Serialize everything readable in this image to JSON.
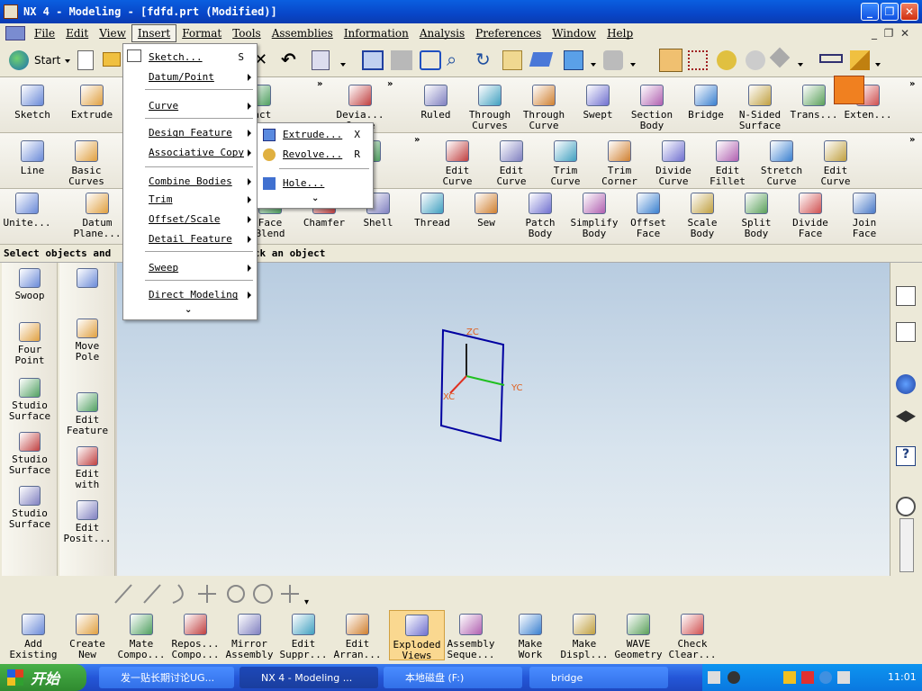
{
  "window": {
    "title": "NX 4 - Modeling - [fdfd.prt (Modified)]"
  },
  "menubar": {
    "items": [
      "File",
      "Edit",
      "View",
      "Insert",
      "Format",
      "Tools",
      "Assemblies",
      "Information",
      "Analysis",
      "Preferences",
      "Window",
      "Help"
    ]
  },
  "toolbar": {
    "start_label": "Start"
  },
  "ribbon1": [
    {
      "label": "Sketch",
      "icon": "sketch-icon"
    },
    {
      "label": "Extrude",
      "icon": "extrude-icon"
    },
    {
      "label": "ract\nature",
      "icon": "extract-feature-icon"
    },
    {
      "label": "Devia...\nCurve",
      "icon": "deviation-icon"
    },
    {
      "label": "Ruled",
      "icon": "ruled-icon"
    },
    {
      "label": "Through\nCurves",
      "icon": "through-curves-icon"
    },
    {
      "label": "Through\nCurve",
      "icon": "through-curve-mesh-icon"
    },
    {
      "label": "Swept",
      "icon": "swept-icon"
    },
    {
      "label": "Section\nBody",
      "icon": "section-body-icon"
    },
    {
      "label": "Bridge",
      "icon": "bridge-icon"
    },
    {
      "label": "N-Sided\nSurface",
      "icon": "n-sided-icon"
    },
    {
      "label": "Trans...",
      "icon": "transition-icon"
    },
    {
      "label": "Exten...",
      "icon": "extension-icon"
    }
  ],
  "ribbon2": [
    {
      "label": "Line",
      "icon": "line-icon"
    },
    {
      "label": "Basic\nCurves",
      "icon": "basic-curves-icon"
    },
    {
      "label": "e",
      "icon": "curve-partial-icon"
    },
    {
      "label": "Edit\nCurve",
      "icon": "edit-curve-icon"
    },
    {
      "label": "Edit\nCurve",
      "icon": "edit-curve-params-icon"
    },
    {
      "label": "Trim\nCurve",
      "icon": "trim-curve-icon"
    },
    {
      "label": "Trim\nCorner",
      "icon": "trim-corner-icon"
    },
    {
      "label": "Divide\nCurve",
      "icon": "divide-curve-icon"
    },
    {
      "label": "Edit\nFillet",
      "icon": "edit-fillet-icon"
    },
    {
      "label": "Stretch\nCurve",
      "icon": "stretch-curve-icon"
    },
    {
      "label": "Edit\nCurve",
      "icon": "edit-curve-length-icon"
    }
  ],
  "ribbon3": [
    {
      "label": "Unite...",
      "icon": "unite-icon"
    },
    {
      "label": "Datum\nPlane...",
      "icon": "datum-plane-icon"
    },
    {
      "label": "Face\nBlend",
      "icon": "face-blend-icon"
    },
    {
      "label": "Chamfer",
      "icon": "chamfer-icon"
    },
    {
      "label": "Shell",
      "icon": "shell-icon"
    },
    {
      "label": "Thread",
      "icon": "thread-icon"
    },
    {
      "label": "Sew",
      "icon": "sew-icon"
    },
    {
      "label": "Patch\nBody",
      "icon": "patch-body-icon"
    },
    {
      "label": "Simplify\nBody",
      "icon": "simplify-body-icon"
    },
    {
      "label": "Offset\nFace",
      "icon": "offset-face-icon"
    },
    {
      "label": "Scale\nBody",
      "icon": "scale-body-icon"
    },
    {
      "label": "Split\nBody",
      "icon": "split-body-icon"
    },
    {
      "label": "Divide\nFace",
      "icon": "divide-face-icon"
    },
    {
      "label": "Join\nFace",
      "icon": "join-face-icon"
    }
  ],
  "status": {
    "left": "Select objects and",
    "right": "ick an object"
  },
  "insert_menu": {
    "items": [
      {
        "label": "Sketch...",
        "shortcut": "S"
      },
      {
        "label": "Datum/Point"
      },
      {
        "label": "Curve"
      },
      {
        "label": "Design Feature"
      },
      {
        "label": "Associative Copy"
      },
      {
        "label": "Combine Bodies"
      },
      {
        "label": "Trim"
      },
      {
        "label": "Offset/Scale"
      },
      {
        "label": "Detail Feature"
      },
      {
        "label": "Sweep"
      },
      {
        "label": "Direct Modeling"
      }
    ]
  },
  "design_feature_menu": {
    "items": [
      {
        "label": "Extrude...",
        "shortcut": "X"
      },
      {
        "label": "Revolve...",
        "shortcut": "R"
      },
      {
        "label": "Hole..."
      }
    ]
  },
  "left_col1": [
    {
      "label": "Swoop",
      "icon": "swoop-icon"
    },
    {
      "label": "Four\nPoint",
      "icon": "four-point-icon"
    },
    {
      "label": "Studio\nSurface",
      "icon": "studio-surface-icon"
    },
    {
      "label": "Studio\nSurface",
      "icon": "studio-surface-2-icon"
    },
    {
      "label": "Studio\nSurface",
      "icon": "studio-surface-3-icon"
    }
  ],
  "left_col2": [
    {
      "label": "",
      "icon": "disabled-tool-icon"
    },
    {
      "label": "Move\nPole",
      "icon": "move-pole-icon"
    },
    {
      "label": "Edit\nFeature",
      "icon": "edit-feature-icon"
    },
    {
      "label": "Edit\nwith",
      "icon": "edit-with-icon"
    },
    {
      "label": "Edit\nPosit...",
      "icon": "edit-position-icon"
    }
  ],
  "viewport": {
    "axis_z": "ZC",
    "axis_y": "YC",
    "axis_x": "XC"
  },
  "assembly_bar": [
    {
      "label": "Add\nExisting",
      "icon": "add-existing-icon"
    },
    {
      "label": "Create\nNew",
      "icon": "create-new-icon"
    },
    {
      "label": "Mate\nCompo...",
      "icon": "mate-component-icon"
    },
    {
      "label": "Repos...\nCompo...",
      "icon": "reposition-icon"
    },
    {
      "label": "Mirror\nAssembly",
      "icon": "mirror-assembly-icon"
    },
    {
      "label": "Edit\nSuppr...",
      "icon": "edit-suppression-icon"
    },
    {
      "label": "Edit\nArran...",
      "icon": "edit-arrangement-icon"
    },
    {
      "label": "Exploded\nViews",
      "icon": "exploded-views-icon",
      "active": true
    },
    {
      "label": "Assembly\nSeque...",
      "icon": "assembly-sequence-icon"
    },
    {
      "label": "Make\nWork",
      "icon": "make-work-icon"
    },
    {
      "label": "Make\nDispl...",
      "icon": "make-displayed-icon"
    },
    {
      "label": "WAVE\nGeometry",
      "icon": "wave-geometry-icon"
    },
    {
      "label": "Check\nClear...",
      "icon": "check-clearance-icon"
    }
  ],
  "taskbar": {
    "start": "开始",
    "items": [
      "发一贴长期讨论UG...",
      "NX 4 - Modeling ...",
      "本地磁盘 (F:)",
      "bridge"
    ],
    "clock": "11:01"
  },
  "colors": {
    "title": "#0a4fd8",
    "accent": "#316ac5",
    "viewport_top": "#b8cce0",
    "wcs_blue": "#0000a0"
  }
}
